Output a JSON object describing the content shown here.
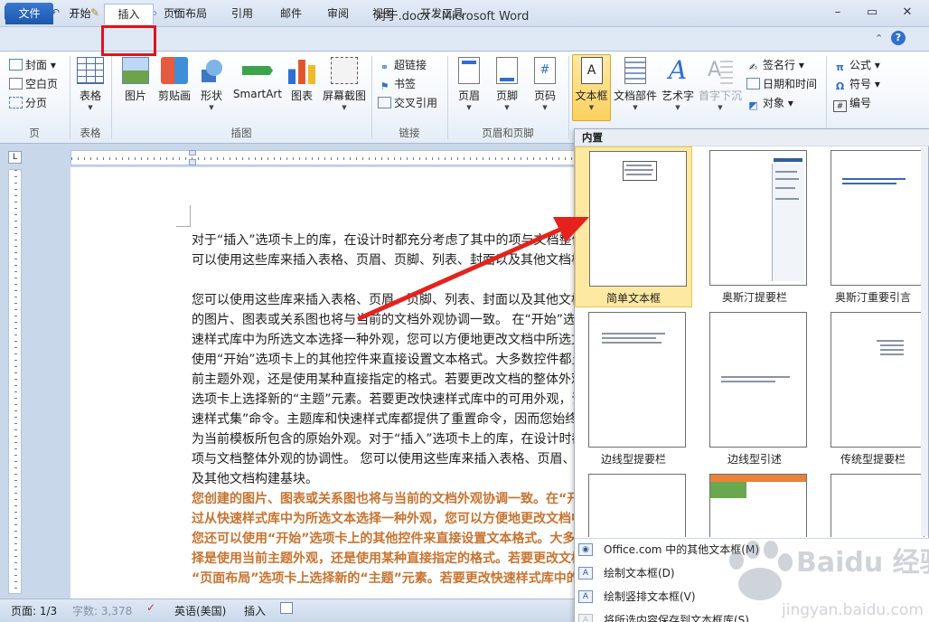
{
  "window": {
    "title": "对于.docx - Microsoft Word",
    "app_icon_letter": "W",
    "controls": {
      "minimize": "–",
      "maximize": "▭",
      "close": "✕"
    }
  },
  "ribbon_tabs": [
    "文件",
    "开始",
    "插入",
    "页面布局",
    "引用",
    "邮件",
    "审阅",
    "视图",
    "开发工具"
  ],
  "active_tab": "插入",
  "ribbon": {
    "pages_group": {
      "label": "页",
      "items": [
        "封面",
        "空白页",
        "分页"
      ]
    },
    "table_group": {
      "label": "表格",
      "table": "表格"
    },
    "illustrations_group": {
      "label": "插图",
      "buttons": [
        "图片",
        "剪贴画",
        "形状",
        "SmartArt",
        "图表",
        "屏幕截图"
      ]
    },
    "links_group": {
      "label": "链接",
      "items": [
        "超链接",
        "书签",
        "交叉引用"
      ]
    },
    "header_footer_group": {
      "label": "页眉和页脚",
      "buttons": [
        "页眉",
        "页脚",
        "页码"
      ]
    },
    "text_group": {
      "buttons": [
        "文本框",
        "文档部件",
        "艺术字",
        "首字下沉"
      ],
      "items": [
        "签名行",
        "日期和时间",
        "对象"
      ]
    },
    "symbols_group": {
      "items": [
        "公式",
        "符号",
        "编号"
      ]
    }
  },
  "gallery": {
    "header": "内置",
    "thumbnails": [
      {
        "caption": "简单文本框",
        "selected": true
      },
      {
        "caption": "奥斯汀提要栏",
        "selected": false
      },
      {
        "caption": "奥斯汀重要引言",
        "selected": false
      },
      {
        "caption": "边线型提要栏",
        "selected": false
      },
      {
        "caption": "边线型引述",
        "selected": false
      },
      {
        "caption": "传统型提要栏",
        "selected": false
      }
    ],
    "menu": [
      {
        "label": "Office.com 中的其他文本框(M)",
        "disabled": false
      },
      {
        "label": "绘制文本框(D)",
        "disabled": false
      },
      {
        "label": "绘制竖排文本框(V)",
        "disabled": false
      },
      {
        "label": "将所选内容保存到文本框库(S)",
        "disabled": true
      }
    ]
  },
  "document": {
    "lines": [
      {
        "text": "对于“插入”选项卡上的库，在设计时都充分考虑了其中的项与文档整体外观的协调性。您",
        "style": "normal"
      },
      {
        "text": "可以使用这些库来插入表格、页眉、页脚、列表、封面以及其他文档构建基块。",
        "style": "normal"
      },
      {
        "text": "",
        "style": "normal"
      },
      {
        "text": "您可以使用这些库来插入表格、页眉、页脚、列表、封面以及其他文档构建基块。您创建",
        "style": "normal"
      },
      {
        "text": "的图片、图表或关系图也将与当前的文档外观协调一致。 在“开始”选项卡上，通过从快",
        "style": "normal"
      },
      {
        "text": "速样式库中为所选文本选择一种外观，您可以方便地更改文档中所选文本的格式。您还可以",
        "style": "normal"
      },
      {
        "text": "使用“开始”选项卡上的其他控件来直接设置文本格式。大多数控件都允许您选择是使用当",
        "style": "normal"
      },
      {
        "text": "前主题外观，还是使用某种直接指定的格式。若要更改文档的整体外观，请在“页面布局”",
        "style": "normal"
      },
      {
        "text": "选项卡上选择新的“主题”元素。若要更改快速样式库中的可用外观，请使用“更改当前快",
        "style": "normal"
      },
      {
        "text": "速样式集”命令。主题库和快速样式库都提供了重置命令，因而您始终可以将文档外观还原",
        "style": "normal"
      },
      {
        "text": "为当前模板所包含的原始外观。对于“插入”选项卡上的库，在设计时都充分考虑了其中的",
        "style": "normal"
      },
      {
        "text": "项与文档整体外观的协调性。 您可以使用这些库来插入表格、页眉、页脚、列表、封面以",
        "style": "normal"
      },
      {
        "text": "及其他文档构建基块。",
        "style": "normal"
      },
      {
        "text": "您创建的图片、图表或关系图也将与当前的文档外观协调一致。在“开始”选项卡上，通",
        "style": "orange"
      },
      {
        "text": "过从快速样式库中为所选文本选择一种外观，您可以方便地更改文档中所选文本的格式。",
        "style": "orange"
      },
      {
        "text": "您还可以使用“开始”选项卡上的其他控件来直接设置文本格式。大多数控件都允许您选",
        "style": "orange"
      },
      {
        "text": "择是使用当前主题外观，还是使用某种直接指定的格式。若要更改文档的整体外观，请在",
        "style": "orange"
      },
      {
        "text": "“页面布局”选项卡上选择新的“主题”元素。若要更改快速样式库中的可用外观，请使",
        "style": "orange"
      }
    ]
  },
  "statusbar": {
    "page": "页面: 1/3",
    "words": "字数: 3,378",
    "language": "英语(美国)",
    "mode": "插入"
  },
  "watermark": {
    "brand": "Baidu 经验",
    "url": "jingyan.baidu.com"
  },
  "colors": {
    "file_tab": "#2a66c0",
    "highlight_box": "#e0141a",
    "arrow": "#e5221c",
    "orange_text": "#c8732f",
    "selected_thumb": "#fde9a2"
  }
}
